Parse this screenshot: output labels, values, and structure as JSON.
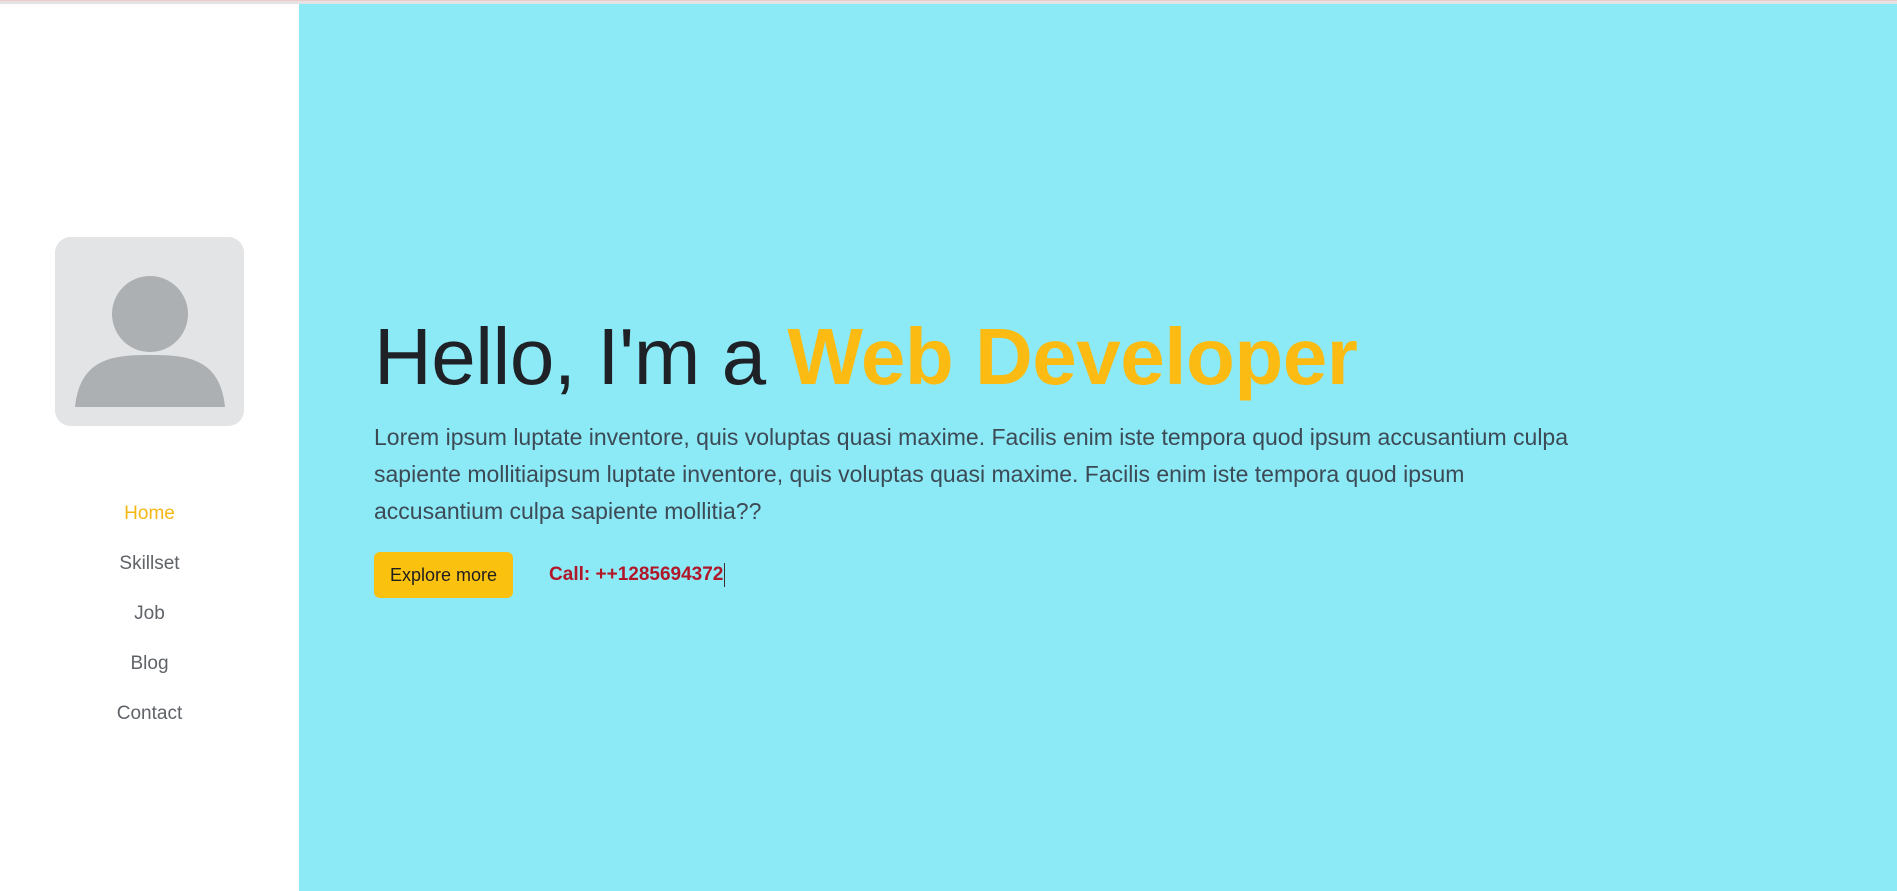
{
  "nav": {
    "items": [
      {
        "label": "Home",
        "active": true
      },
      {
        "label": "Skillset",
        "active": false
      },
      {
        "label": "Job",
        "active": false
      },
      {
        "label": "Blog",
        "active": false
      },
      {
        "label": "Contact",
        "active": false
      }
    ]
  },
  "avatar": {
    "icon": "user-placeholder-icon"
  },
  "hero": {
    "headline_prefix": "Hello, I'm a ",
    "headline_accent": "Web Developer",
    "lead": "Lorem ipsum luptate inventore, quis voluptas quasi maxime. Facilis enim iste tempora quod ipsum accusantium culpa sapiente mollitiaipsum luptate inventore, quis voluptas quasi maxime. Facilis enim iste tempora quod ipsum accusantium culpa sapiente mollitia??",
    "button_label": "Explore more",
    "call_text": "Call: ++1285694372"
  },
  "colors": {
    "accent": "#fbbb13",
    "main_bg": "#8ce9f6",
    "call": "#b0182a",
    "nav_active": "#f5b714"
  }
}
